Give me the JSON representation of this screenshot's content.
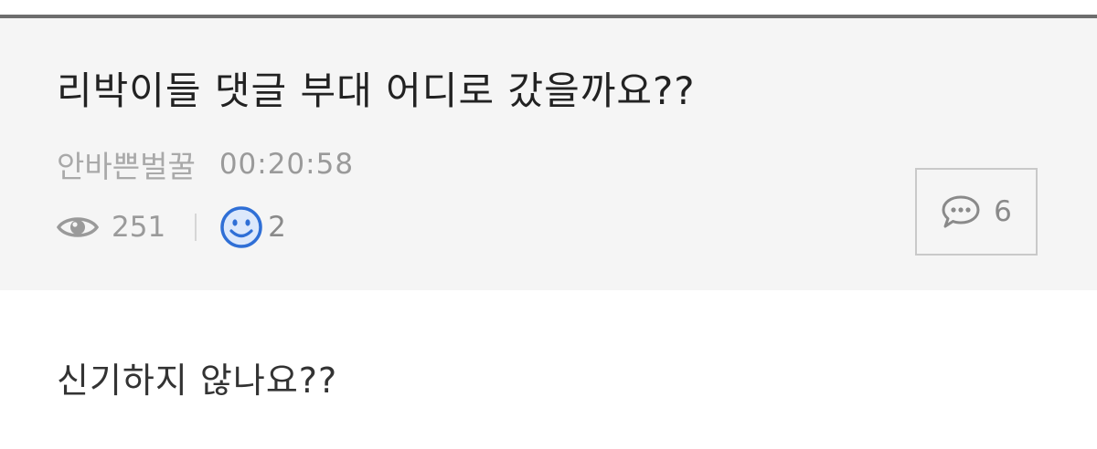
{
  "post": {
    "title": "리박이들 댓글 부대 어디로 갔을까요??",
    "author": "안바쁜벌꿀",
    "time": "00:20:58",
    "views": "251",
    "likes": "2",
    "comment_count": "6",
    "body": "신기하지 않나요??"
  },
  "icons": {
    "views": "eye-icon",
    "likes": "smile-icon",
    "comments": "speech-bubble-icon"
  },
  "colors": {
    "header_background": "#f5f5f5",
    "top_rule": "#6e6e6e",
    "like_icon": "#2f6fd6",
    "muted_text": "#9a9a9a"
  }
}
